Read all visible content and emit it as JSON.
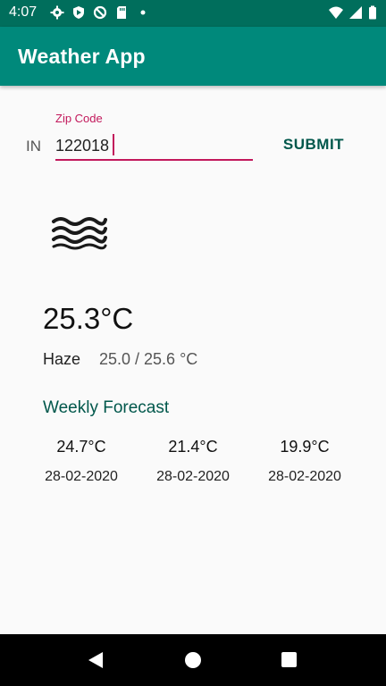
{
  "status_bar": {
    "time": "4:07",
    "icons": [
      "settings-icon",
      "shield-icon",
      "blocked-icon",
      "sd-card-icon",
      "dot-icon",
      "wifi-icon",
      "signal-icon",
      "battery-icon"
    ]
  },
  "app_bar": {
    "title": "Weather App"
  },
  "search": {
    "country_code": "IN",
    "zip_label": "Zip Code",
    "zip_value": "122018",
    "submit_label": "SUBMIT"
  },
  "current": {
    "icon": "haze-icon",
    "temperature": "25.3°C",
    "condition": "Haze",
    "range": "25.0 / 25.6 °C"
  },
  "forecast": {
    "title": "Weekly Forecast",
    "items": [
      {
        "temp": "24.7°C",
        "date": "28-02-2020"
      },
      {
        "temp": "21.4°C",
        "date": "28-02-2020"
      },
      {
        "temp": "19.9°C",
        "date": "28-02-2020"
      }
    ]
  },
  "colors": {
    "status_bar": "#006e5c",
    "app_bar": "#00897b",
    "accent": "#c2185b",
    "button_text": "#00574b"
  }
}
